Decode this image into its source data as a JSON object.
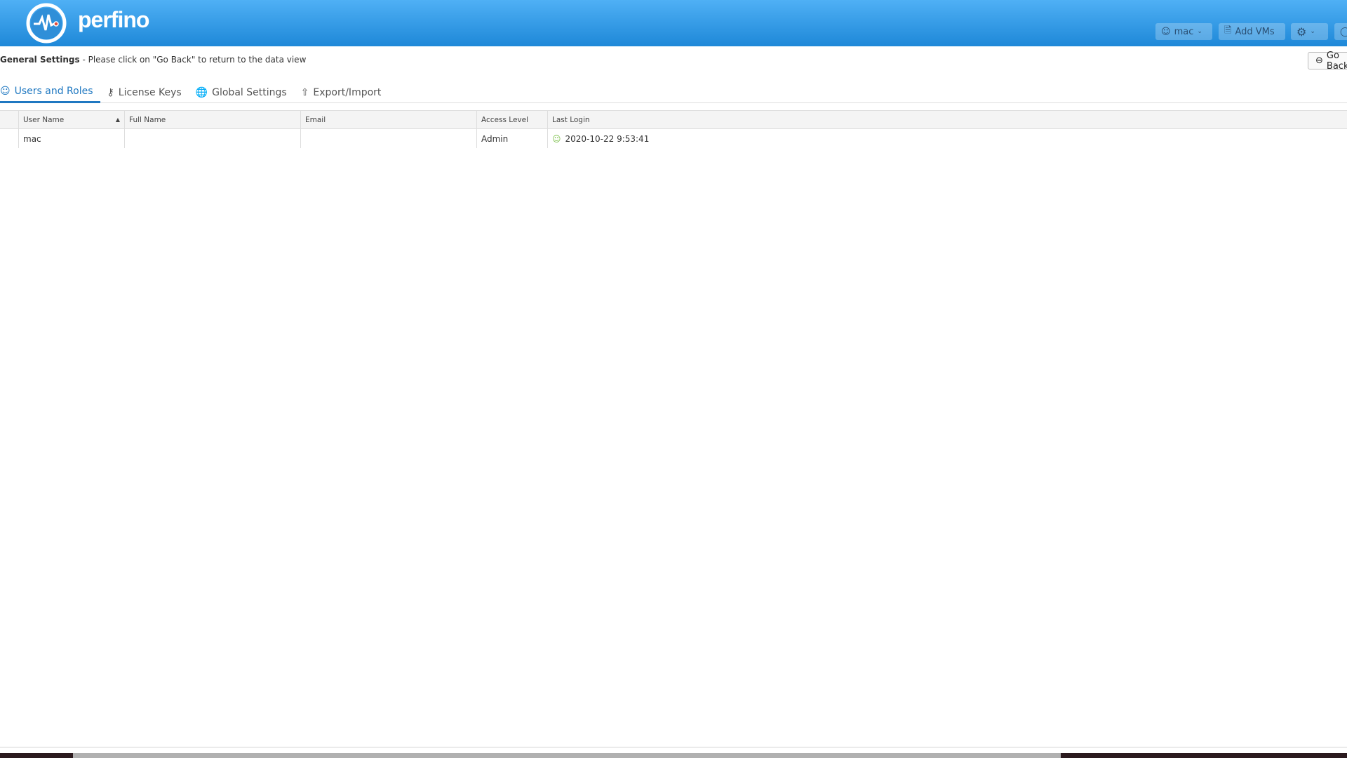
{
  "header": {
    "brand": "perfino",
    "user_button": "mac",
    "add_vms_button": "Add VMs"
  },
  "subheader": {
    "title": "General Settings",
    "message": " - Please click on \"Go Back\" to return to the data view",
    "go_back": "Go Back"
  },
  "tabs": [
    {
      "label": "Users and Roles",
      "active": true,
      "icon": "user-icon"
    },
    {
      "label": "License Keys",
      "icon": "key-icon"
    },
    {
      "label": "Global Settings",
      "icon": "globe-icon"
    },
    {
      "label": "Export/Import",
      "icon": "export-icon"
    }
  ],
  "table": {
    "columns": [
      "User Name",
      "Full Name",
      "Email",
      "Access Level",
      "Last Login"
    ],
    "sort": {
      "column": "User Name",
      "direction": "ascending"
    },
    "rows": [
      {
        "user_name": "mac",
        "full_name": "",
        "email": "",
        "access_level": "Admin",
        "last_login": "2020-10-22 9:53:41"
      }
    ]
  },
  "colors": {
    "header": "#1e88d8",
    "accent": "#1f78c1",
    "login_icon": "#7cc04b"
  }
}
